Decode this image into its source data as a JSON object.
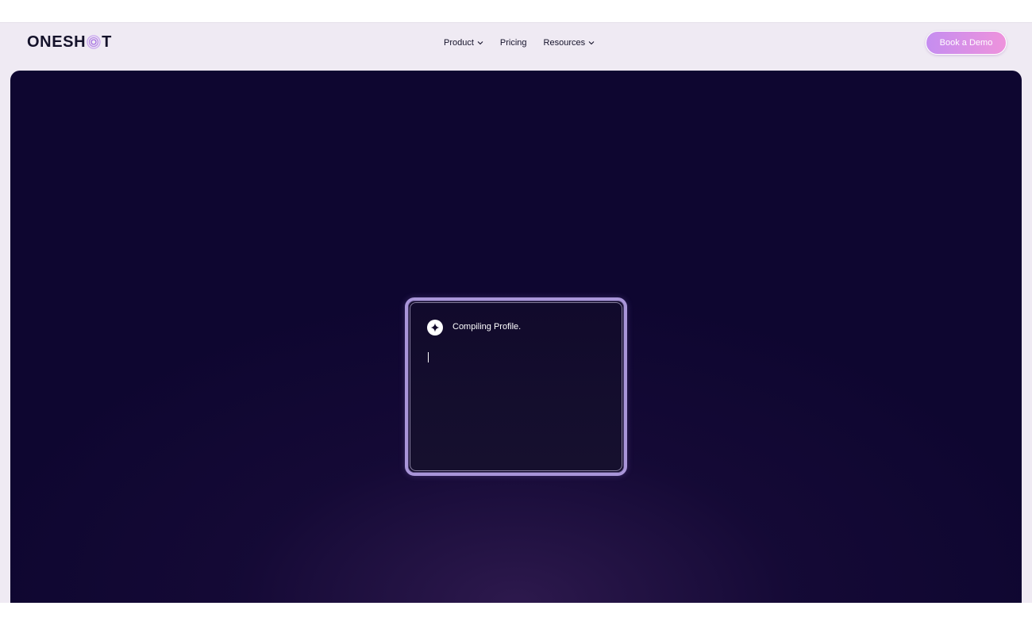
{
  "brand": {
    "logo_prefix": "ONESH",
    "logo_suffix": "T",
    "logo_accent": "#b98be8"
  },
  "nav": {
    "items": [
      {
        "label": "Product",
        "has_dropdown": true
      },
      {
        "label": "Pricing",
        "has_dropdown": false
      },
      {
        "label": "Resources",
        "has_dropdown": true
      }
    ],
    "cta_label": "Book a Demo"
  },
  "hero": {
    "background": "#0e0630",
    "card": {
      "icon": "sparkle-icon",
      "status_text": "Compiling Profile.",
      "border_color": "#a995d9"
    }
  }
}
